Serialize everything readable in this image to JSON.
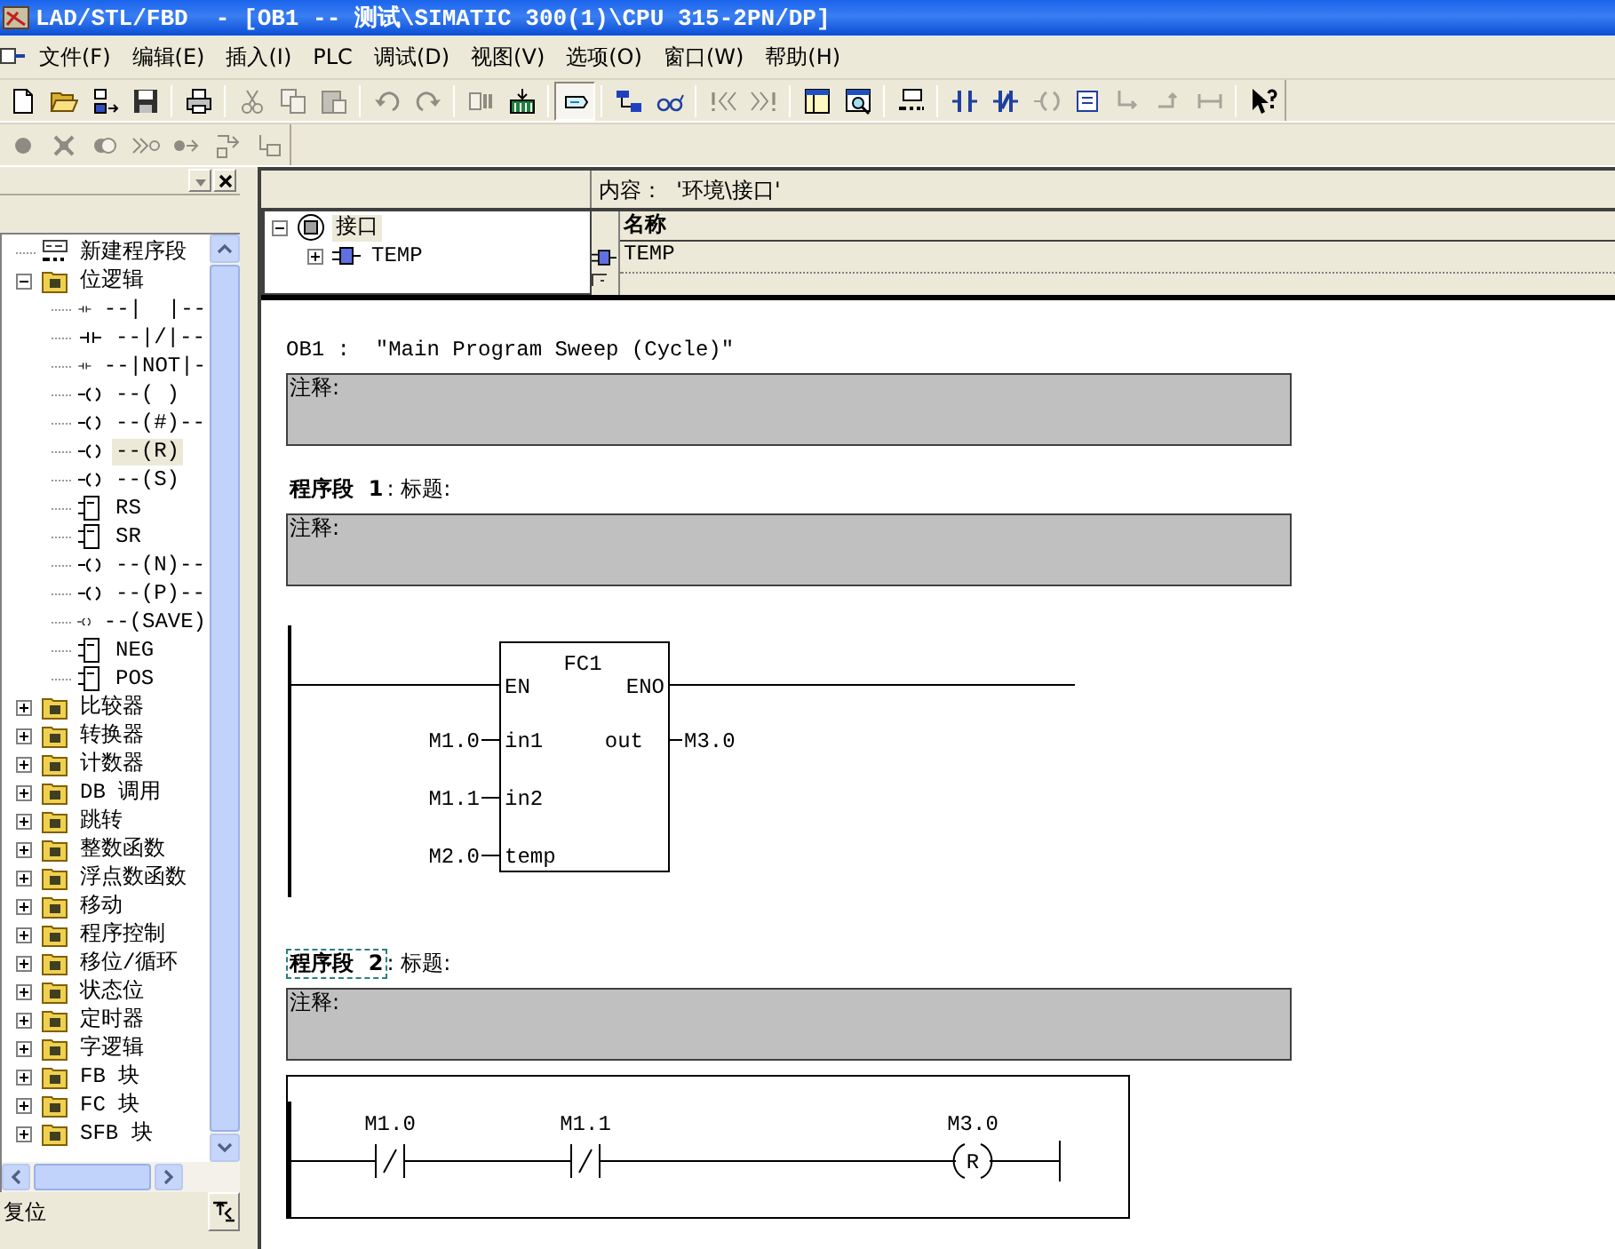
{
  "window": {
    "title": "LAD/STL/FBD  - [OB1 -- 测试\\SIMATIC 300(1)\\CPU 315-2PN/DP]"
  },
  "menu": [
    {
      "label": "文件(F)"
    },
    {
      "label": "编辑(E)"
    },
    {
      "label": "插入(I)"
    },
    {
      "label": "PLC"
    },
    {
      "label": "调试(D)"
    },
    {
      "label": "视图(V)"
    },
    {
      "label": "选项(O)"
    },
    {
      "label": "窗口(W)"
    },
    {
      "label": "帮助(H)"
    }
  ],
  "toolbar": {
    "groups": [
      {
        "buttons": [
          {
            "kind": "new",
            "disabled": false,
            "pressed": false
          },
          {
            "kind": "open",
            "disabled": false,
            "pressed": false
          },
          {
            "kind": "nodes",
            "disabled": false,
            "pressed": false
          },
          {
            "kind": "save",
            "disabled": false,
            "pressed": false
          }
        ]
      },
      {
        "buttons": [
          {
            "kind": "print",
            "disabled": false,
            "pressed": false
          }
        ]
      },
      {
        "buttons": [
          {
            "kind": "cut",
            "disabled": true,
            "pressed": false
          },
          {
            "kind": "copy",
            "disabled": true,
            "pressed": false
          },
          {
            "kind": "paste",
            "disabled": true,
            "pressed": false
          }
        ]
      },
      {
        "buttons": [
          {
            "kind": "undo",
            "disabled": true,
            "pressed": false
          },
          {
            "kind": "redo",
            "disabled": true,
            "pressed": false
          }
        ]
      },
      {
        "buttons": [
          {
            "kind": "module",
            "disabled": true,
            "pressed": false
          },
          {
            "kind": "plcload",
            "disabled": false,
            "pressed": false
          }
        ]
      },
      {
        "buttons": [
          {
            "kind": "display",
            "disabled": false,
            "pressed": true
          }
        ]
      },
      {
        "buttons": [
          {
            "kind": "network",
            "disabled": false,
            "pressed": false
          },
          {
            "kind": "glasses",
            "disabled": false,
            "pressed": false
          }
        ]
      },
      {
        "buttons": [
          {
            "kind": "prev",
            "disabled": true,
            "pressed": false
          },
          {
            "kind": "next",
            "disabled": true,
            "pressed": false
          }
        ]
      },
      {
        "buttons": [
          {
            "kind": "panel",
            "disabled": false,
            "pressed": false
          },
          {
            "kind": "zoom",
            "disabled": false,
            "pressed": false
          }
        ]
      },
      {
        "buttons": [
          {
            "kind": "newnet",
            "disabled": false,
            "pressed": false
          }
        ]
      },
      {
        "buttons": [
          {
            "kind": "contact",
            "disabled": false,
            "pressed": false
          },
          {
            "kind": "nc",
            "disabled": false,
            "pressed": false
          },
          {
            "kind": "coil",
            "disabled": true,
            "pressed": false
          },
          {
            "kind": "box",
            "disabled": false,
            "pressed": false
          },
          {
            "kind": "bopen",
            "disabled": true,
            "pressed": false
          },
          {
            "kind": "bclose",
            "disabled": true,
            "pressed": false
          },
          {
            "kind": "wire",
            "disabled": true,
            "pressed": false
          }
        ]
      },
      {
        "buttons": [
          {
            "kind": "help",
            "disabled": false,
            "pressed": false
          }
        ]
      }
    ]
  },
  "toolbar2": {
    "groups": [
      {
        "buttons": [
          {
            "kind": "bp",
            "disabled": true,
            "pressed": false
          },
          {
            "kind": "bpclear",
            "disabled": true,
            "pressed": false
          },
          {
            "kind": "bpactive",
            "disabled": true,
            "pressed": false
          },
          {
            "kind": "nextstmt",
            "disabled": true,
            "pressed": false
          },
          {
            "kind": "step",
            "disabled": true,
            "pressed": false
          },
          {
            "kind": "cont",
            "disabled": true,
            "pressed": false
          },
          {
            "kind": "stop",
            "disabled": true,
            "pressed": false
          }
        ]
      }
    ]
  },
  "sidebar": {
    "tree": [
      {
        "kind": "network",
        "label": "新建程序段",
        "selected": false
      },
      {
        "kind": "folder",
        "label": "位逻辑",
        "selected": false,
        "expanded": true,
        "children": [
          {
            "kind": "contact",
            "label": "--|  |--",
            "selected": false
          },
          {
            "kind": "contact",
            "label": "--|/|--",
            "selected": false
          },
          {
            "kind": "contact",
            "label": "--|NOT|-",
            "selected": false
          },
          {
            "kind": "coil",
            "label": "--( )",
            "selected": false
          },
          {
            "kind": "coil",
            "label": "--(#)--",
            "selected": false
          },
          {
            "kind": "coil",
            "label": "--(R)",
            "selected": true
          },
          {
            "kind": "coil",
            "label": "--(S)",
            "selected": false
          },
          {
            "kind": "box",
            "label": "RS",
            "selected": false
          },
          {
            "kind": "box",
            "label": "SR",
            "selected": false
          },
          {
            "kind": "coil",
            "label": "--(N)--",
            "selected": false
          },
          {
            "kind": "coil",
            "label": "--(P)--",
            "selected": false
          },
          {
            "kind": "coil",
            "label": "--(SAVE)",
            "selected": false
          },
          {
            "kind": "box",
            "label": "NEG",
            "selected": false
          },
          {
            "kind": "box",
            "label": "POS",
            "selected": false
          }
        ]
      },
      {
        "kind": "folder",
        "label": "比较器",
        "selected": false,
        "expanded": false
      },
      {
        "kind": "folder",
        "label": "转换器",
        "selected": false,
        "expanded": false
      },
      {
        "kind": "folder",
        "label": "计数器",
        "selected": false,
        "expanded": false
      },
      {
        "kind": "folder",
        "label": "DB 调用",
        "selected": false,
        "expanded": false
      },
      {
        "kind": "folder",
        "label": "跳转",
        "selected": false,
        "expanded": false
      },
      {
        "kind": "folder",
        "label": "整数函数",
        "selected": false,
        "expanded": false
      },
      {
        "kind": "folder",
        "label": "浮点数函数",
        "selected": false,
        "expanded": false
      },
      {
        "kind": "folder",
        "label": "移动",
        "selected": false,
        "expanded": false
      },
      {
        "kind": "folder",
        "label": "程序控制",
        "selected": false,
        "expanded": false
      },
      {
        "kind": "folder",
        "label": "移位/循环",
        "selected": false,
        "expanded": false
      },
      {
        "kind": "folder",
        "label": "状态位",
        "selected": false,
        "expanded": false
      },
      {
        "kind": "folder",
        "label": "定时器",
        "selected": false,
        "expanded": false
      },
      {
        "kind": "folder",
        "label": "字逻辑",
        "selected": false,
        "expanded": false
      },
      {
        "kind": "folder",
        "label": "FB 块",
        "selected": false,
        "expanded": false
      },
      {
        "kind": "folder",
        "label": "FC 块",
        "selected": false,
        "expanded": false
      },
      {
        "kind": "folder",
        "label": "SFB 块",
        "selected": false,
        "expanded": false
      }
    ],
    "status": "复位"
  },
  "interface": {
    "tree": [
      {
        "kind": "interface",
        "label": "接口",
        "selected": true,
        "expanded": true,
        "children": [
          {
            "kind": "variable",
            "label": "TEMP",
            "selected": false,
            "expanded": false
          }
        ]
      }
    ],
    "content_label": "内容：  '环境\\接口'",
    "columns": [
      "名称"
    ],
    "rows": [
      "TEMP"
    ]
  },
  "editor": {
    "block_title": "OB1 :  ″Main Program Sweep (Cycle)″",
    "block_comment": "注释:",
    "networks": [
      {
        "label": "程序段  1",
        "title": ": 标题:",
        "comment": "注释:",
        "focused": false,
        "selected": false,
        "diagram": {
          "kind": "fbd",
          "name": "FC1",
          "en": "EN",
          "eno": "ENO",
          "inputs": [
            {
              "pin": "in1",
              "operand": "M1.0"
            },
            {
              "pin": "in2",
              "operand": "M1.1"
            },
            {
              "pin": "temp",
              "operand": "M2.0"
            }
          ],
          "outputs": [
            {
              "pin": "out",
              "operand": "M3.0"
            }
          ]
        }
      },
      {
        "label": "程序段  2",
        "title": ": 标题:",
        "comment": "注释:",
        "focused": true,
        "selected": true,
        "diagram": {
          "kind": "ladder",
          "elements": [
            {
              "kind": "nc",
              "operand": "M1.0"
            },
            {
              "kind": "nc",
              "operand": "M1.1"
            },
            {
              "kind": "coil",
              "symbol": "R",
              "operand": "M3.0"
            }
          ]
        }
      }
    ]
  }
}
